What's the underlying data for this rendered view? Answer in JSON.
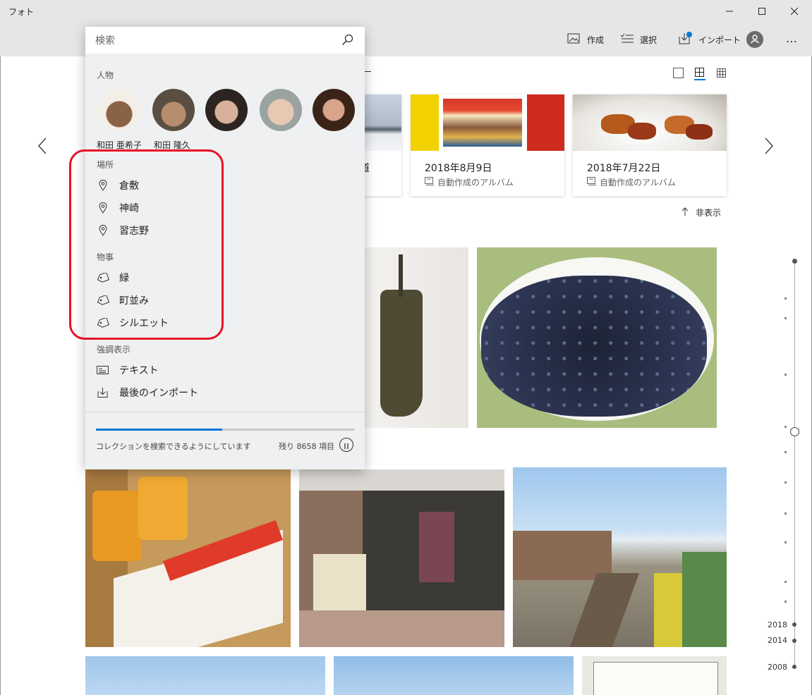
{
  "app": {
    "title": "フォト"
  },
  "window": {
    "minimize": "minimize-icon",
    "maximize": "maximize-icon",
    "close": "close-icon"
  },
  "toolbar": {
    "create": "作成",
    "select": "選択",
    "import": "インポート",
    "more": "…"
  },
  "search": {
    "placeholder": "検索"
  },
  "people": {
    "header": "人物",
    "items": [
      {
        "name": "和田 亜希子"
      },
      {
        "name": "和田 隆久"
      },
      {
        "name": ""
      },
      {
        "name": ""
      },
      {
        "name": ""
      }
    ]
  },
  "places": {
    "header": "場所",
    "items": [
      {
        "label": "倉敷"
      },
      {
        "label": "神崎"
      },
      {
        "label": "習志野"
      }
    ]
  },
  "things": {
    "header": "物事",
    "items": [
      {
        "label": "緑"
      },
      {
        "label": "町並み"
      },
      {
        "label": "シルエット"
      }
    ]
  },
  "highlights": {
    "header": "強調表示",
    "items": [
      {
        "label": "テキスト"
      },
      {
        "label": "最後のインポート"
      }
    ]
  },
  "indexing": {
    "status": "コレクションを検索できるようにしています",
    "remaining": "残り 8658 項目",
    "progress": 0.49
  },
  "albums": [
    {
      "title": "道",
      "subtitle": ""
    },
    {
      "title": "2018年8月9日",
      "subtitle": "自動作成のアルバム"
    },
    {
      "title": "2018年7月22日",
      "subtitle": "自動作成のアルバム"
    }
  ],
  "hide_label": "非表示",
  "timeline": {
    "years": [
      "2018",
      "2014",
      "2008"
    ]
  },
  "colors": {
    "accent": "#0078d7",
    "highlight_ring": "#e81123"
  }
}
